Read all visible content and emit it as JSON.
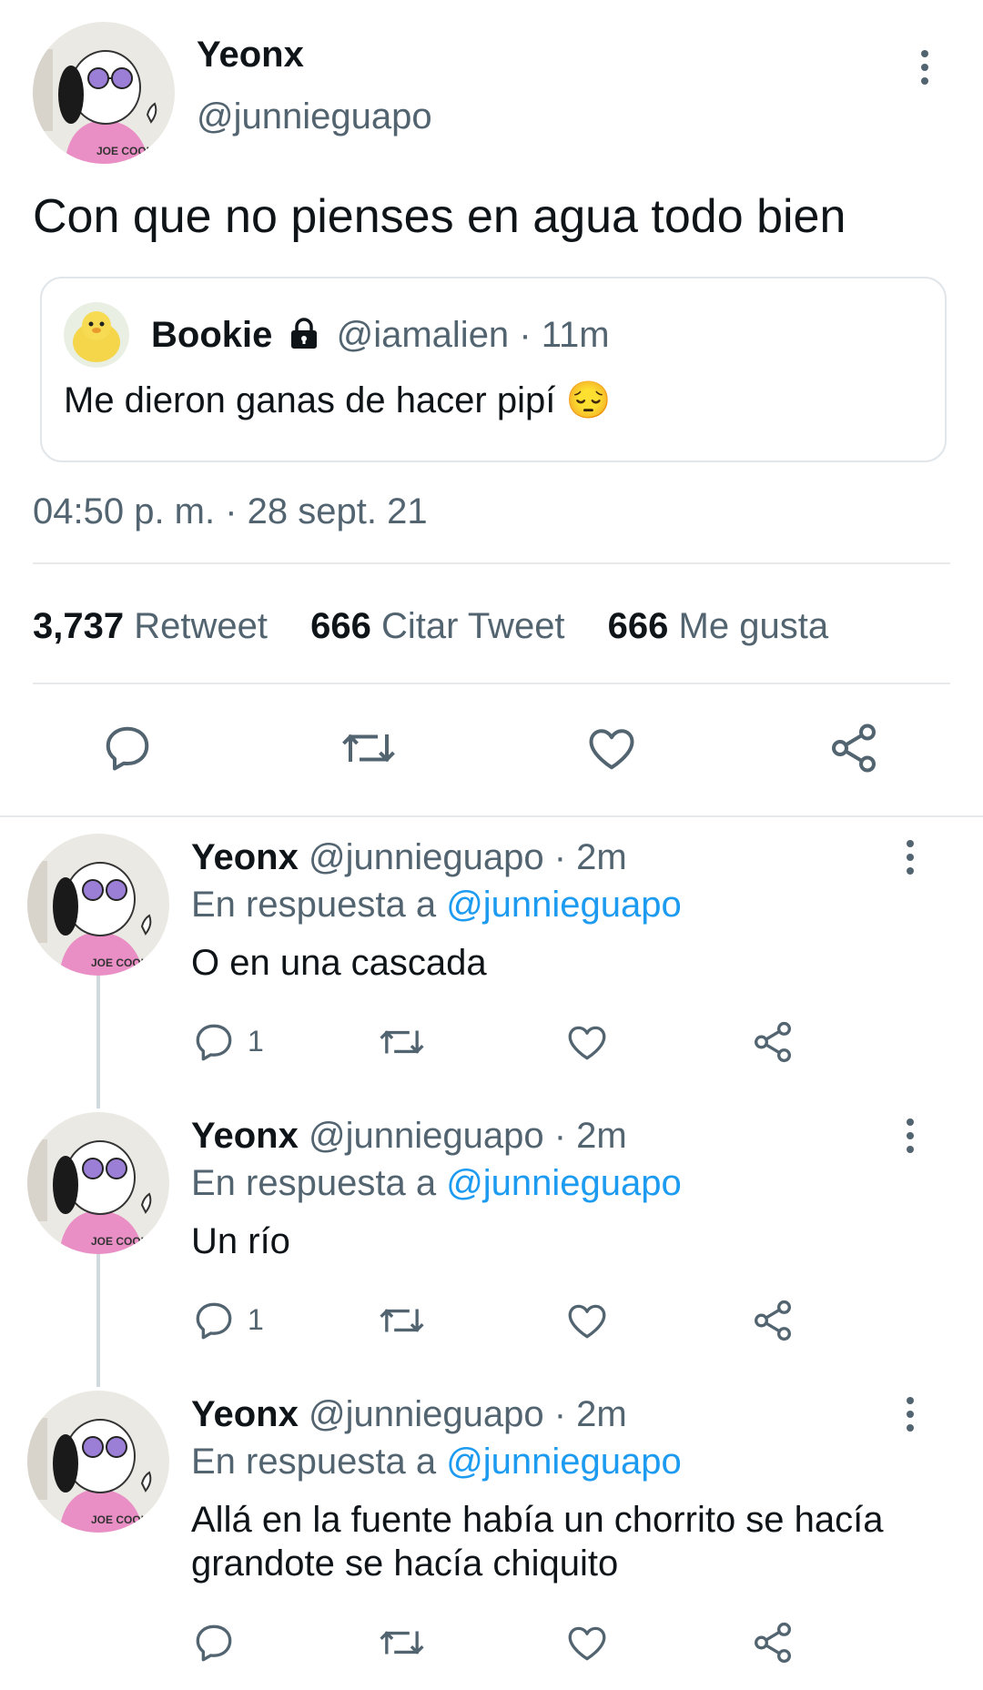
{
  "main_tweet": {
    "author_name": "Yeonx",
    "handle": "@junnieguapo",
    "text": "Con que no pienses en agua todo bien",
    "timestamp": "04:50 p. m. · 28 sept. 21",
    "stats": {
      "retweets_count": "3,737",
      "retweets_label": "Retweet",
      "quotes_count": "666",
      "quotes_label": "Citar Tweet",
      "likes_count": "666",
      "likes_label": "Me gusta"
    },
    "avatar_text": "JOE COOL"
  },
  "quoted_tweet": {
    "author_name": "Bookie",
    "handle": "@iamalien",
    "time": "· 11m",
    "text": "Me dieron ganas de hacer pipí 😔"
  },
  "replies": [
    {
      "author_name": "Yeonx",
      "handle": "@junnieguapo",
      "time": "· 2m",
      "reply_prefix": "En respuesta a",
      "reply_to": "@junnieguapo",
      "text": "O en una cascada",
      "reply_count": "1"
    },
    {
      "author_name": "Yeonx",
      "handle": "@junnieguapo",
      "time": "· 2m",
      "reply_prefix": "En respuesta a",
      "reply_to": "@junnieguapo",
      "text": "Un río",
      "reply_count": "1"
    },
    {
      "author_name": "Yeonx",
      "handle": "@junnieguapo",
      "time": "· 2m",
      "reply_prefix": "En respuesta a",
      "reply_to": "@junnieguapo",
      "text": "Allá en la fuente había un chorrito se hacía grandote se hacía chiquito",
      "reply_count": ""
    }
  ],
  "colors": {
    "accent": "#1d9bf0",
    "muted": "#536471",
    "text": "#0f1419",
    "divider": "#e7e9ea"
  },
  "icons": [
    "reply-icon",
    "retweet-icon",
    "like-icon",
    "share-icon",
    "more-icon",
    "lock-icon"
  ]
}
